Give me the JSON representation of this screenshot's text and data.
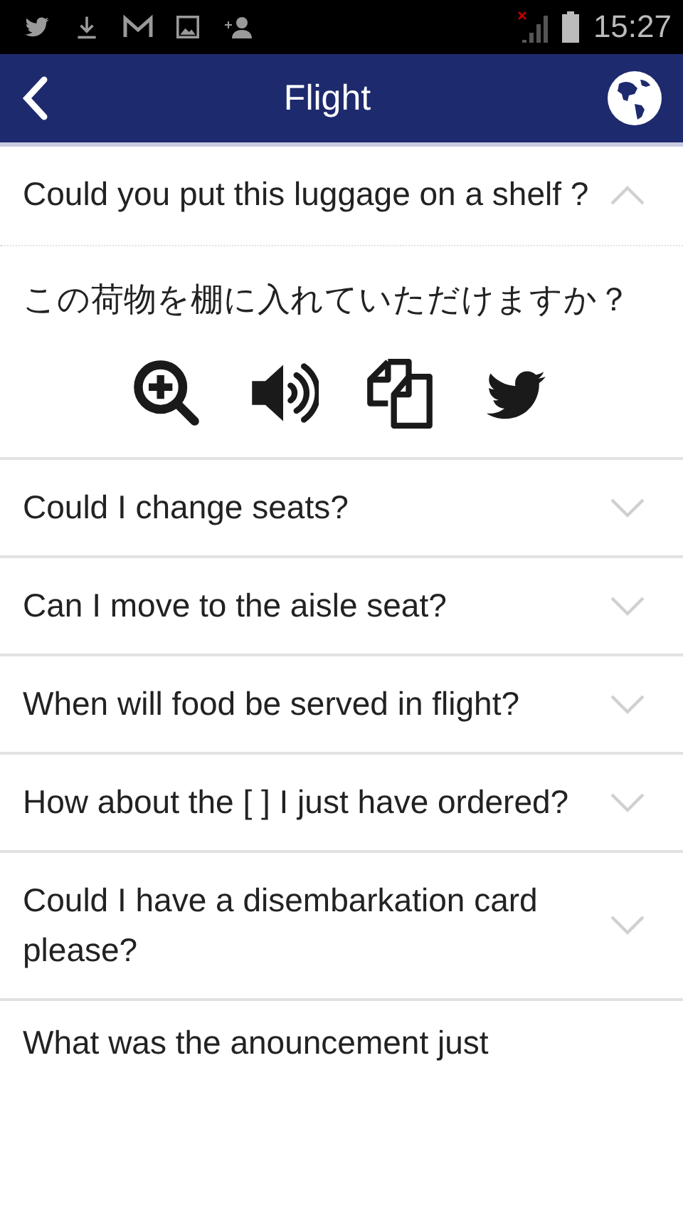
{
  "status_bar": {
    "time": "15:27"
  },
  "header": {
    "title": "Flight"
  },
  "phrases": [
    {
      "question": "Could you put this luggage on a shelf ?",
      "expanded": true,
      "translation": "この荷物を棚に入れていただけますか？"
    },
    {
      "question": "Could I change seats?",
      "expanded": false
    },
    {
      "question": "Can I move to the aisle seat?",
      "expanded": false
    },
    {
      "question": "When will food be served in flight?",
      "expanded": false
    },
    {
      "question": "How about the [ ] I just have ordered?",
      "expanded": false
    },
    {
      "question": "Could I have a disembarkation card please?",
      "expanded": false
    },
    {
      "question": "What was the anouncement just",
      "expanded": false
    }
  ]
}
